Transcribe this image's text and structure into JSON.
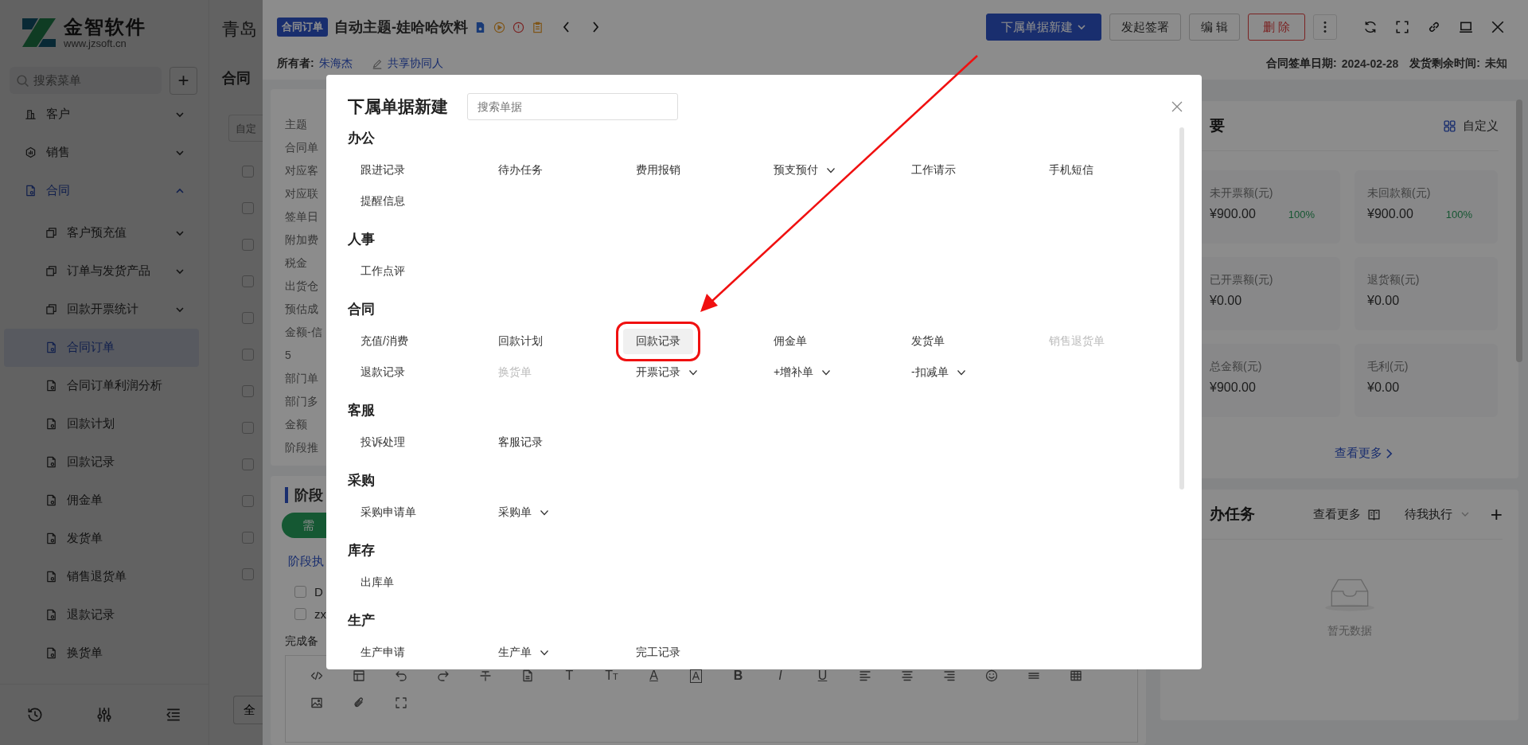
{
  "sidebar": {
    "logo": {
      "name": "金智软件",
      "url": "www.jzsoft.cn"
    },
    "search": {
      "placeholder": "搜索菜单"
    },
    "add_button": "+",
    "items": [
      {
        "label": "客户",
        "expanded": false
      },
      {
        "label": "销售",
        "expanded": false
      },
      {
        "label": "合同",
        "expanded": true,
        "children": [
          {
            "label": "客户预充值",
            "selected": false,
            "expanded": false
          },
          {
            "label": "订单与发货产品",
            "selected": false,
            "expanded": false
          },
          {
            "label": "回款开票统计",
            "selected": false,
            "expanded": false
          },
          {
            "label": "合同订单",
            "selected": true
          },
          {
            "label": "合同订单利润分析",
            "selected": false
          },
          {
            "label": "回款计划",
            "selected": false
          },
          {
            "label": "回款记录",
            "selected": false
          },
          {
            "label": "佣金单",
            "selected": false
          },
          {
            "label": "发货单",
            "selected": false
          },
          {
            "label": "销售退货单",
            "selected": false
          },
          {
            "label": "退款记录",
            "selected": false
          },
          {
            "label": "换货单",
            "selected": false
          }
        ]
      }
    ]
  },
  "background_page": {
    "title": "青岛",
    "section_title": "合同",
    "filter": {
      "placeholder": "自定"
    },
    "list_checkboxes": [
      {
        "checked": false
      },
      {
        "checked": false
      },
      {
        "checked": false
      },
      {
        "checked": false
      },
      {
        "checked": false
      },
      {
        "checked": false
      },
      {
        "checked": false
      },
      {
        "checked": false
      },
      {
        "checked": false
      },
      {
        "checked": false
      },
      {
        "checked": false
      },
      {
        "checked": false
      }
    ],
    "footer_button": "全"
  },
  "drawer": {
    "tag": "合同订单",
    "title": "自动主题-娃哈哈饮料",
    "buttons": [
      {
        "label": "下属单据新建",
        "kind": "primary"
      },
      {
        "label": "发起签署",
        "kind": "default"
      },
      {
        "label": "编 辑",
        "kind": "default"
      },
      {
        "label": "删 除",
        "kind": "danger"
      }
    ],
    "owner_label": "所有者:",
    "owner": "朱海杰",
    "share_link": "共享协同人",
    "meta": [
      {
        "label": "合同签单日期:",
        "value": "2024-02-28"
      },
      {
        "label": "发货剩余时间:",
        "value": "未知"
      }
    ]
  },
  "detail_fields": [
    "主题",
    "合同单",
    "对应客",
    "对应联",
    "签单日",
    "附加费",
    "税金",
    "出货仓",
    "预估成",
    "金额-信",
    "5",
    "部门单",
    "部门多",
    "金额",
    "阶段推"
  ],
  "stage": {
    "title": "阶段",
    "stage_button": "需",
    "link": "阶段执",
    "checklist": [
      {
        "label": "D",
        "checked": false
      },
      {
        "label": "zx",
        "checked": false
      }
    ],
    "remark_label": "完成备",
    "toolbar_glyphs": [
      {
        "text": "T",
        "kind": "plain"
      },
      {
        "text": "T",
        "small": "T",
        "kind": "plain"
      },
      {
        "text": "A",
        "kind": "underline"
      },
      {
        "text": "A",
        "kind": "boxed"
      },
      {
        "text": "B",
        "kind": "bold"
      },
      {
        "text": "I",
        "kind": "italic"
      },
      {
        "text": "U",
        "kind": "underline"
      }
    ]
  },
  "summary": {
    "title": "要",
    "customize": "自定义",
    "more": "查看更多",
    "tiles": [
      {
        "label": "未开票额(元)",
        "value": "¥900.00",
        "percent": "100%"
      },
      {
        "label": "未回款额(元)",
        "value": "¥900.00",
        "percent": "100%"
      },
      {
        "label": "已开票额(元)",
        "value": "¥0.00"
      },
      {
        "label": "退货额(元)",
        "value": "¥0.00"
      },
      {
        "label": "总金额(元)",
        "value": "¥900.00"
      },
      {
        "label": "毛利(元)",
        "value": "¥0.00"
      }
    ]
  },
  "tasks": {
    "title": "办任务",
    "more": "查看更多",
    "filter": "待我执行",
    "add": "+",
    "empty": "暂无数据"
  },
  "modal": {
    "title": "下属单据新建",
    "search": {
      "placeholder": "搜索单据"
    },
    "sections": [
      {
        "title": "办公",
        "items": [
          {
            "label": "跟进记录",
            "disabled": false,
            "menu": false,
            "selected": false
          },
          {
            "label": "待办任务",
            "disabled": false,
            "menu": false,
            "selected": false
          },
          {
            "label": "费用报销",
            "disabled": false,
            "menu": false,
            "selected": false
          },
          {
            "label": "预支预付",
            "disabled": false,
            "menu": true,
            "selected": false
          },
          {
            "label": "工作请示",
            "disabled": false,
            "menu": false,
            "selected": false
          },
          {
            "label": "手机短信",
            "disabled": false,
            "menu": false,
            "selected": false
          },
          {
            "label": "提醒信息",
            "disabled": false,
            "menu": false,
            "selected": false
          }
        ]
      },
      {
        "title": "人事",
        "items": [
          {
            "label": "工作点评",
            "disabled": false,
            "menu": false,
            "selected": false
          }
        ]
      },
      {
        "title": "合同",
        "items": [
          {
            "label": "充值/消费",
            "disabled": false,
            "menu": false,
            "selected": false
          },
          {
            "label": "回款计划",
            "disabled": false,
            "menu": false,
            "selected": false
          },
          {
            "label": "回款记录",
            "disabled": false,
            "menu": false,
            "selected": true
          },
          {
            "label": "佣金单",
            "disabled": false,
            "menu": false,
            "selected": false
          },
          {
            "label": "发货单",
            "disabled": false,
            "menu": false,
            "selected": false
          },
          {
            "label": "销售退货单",
            "disabled": true,
            "menu": false,
            "selected": false
          },
          {
            "label": "退款记录",
            "disabled": false,
            "menu": false,
            "selected": false
          },
          {
            "label": "换货单",
            "disabled": true,
            "menu": false,
            "selected": false
          },
          {
            "label": "开票记录",
            "disabled": false,
            "menu": true,
            "selected": false
          },
          {
            "label": "+增补单",
            "disabled": false,
            "menu": true,
            "selected": false
          },
          {
            "label": "-扣减单",
            "disabled": false,
            "menu": true,
            "selected": false
          }
        ]
      },
      {
        "title": "客服",
        "items": [
          {
            "label": "投诉处理",
            "disabled": false,
            "menu": false,
            "selected": false
          },
          {
            "label": "客服记录",
            "disabled": false,
            "menu": false,
            "selected": false
          }
        ]
      },
      {
        "title": "采购",
        "items": [
          {
            "label": "采购申请单",
            "disabled": false,
            "menu": false,
            "selected": false
          },
          {
            "label": "采购单",
            "disabled": false,
            "menu": true,
            "selected": false
          }
        ]
      },
      {
        "title": "库存",
        "items": [
          {
            "label": "出库单",
            "disabled": false,
            "menu": false,
            "selected": false
          }
        ]
      },
      {
        "title": "生产",
        "items": [
          {
            "label": "生产申请",
            "disabled": false,
            "menu": false,
            "selected": false
          },
          {
            "label": "生产单",
            "disabled": false,
            "menu": true,
            "selected": false
          },
          {
            "label": "完工记录",
            "disabled": false,
            "menu": false,
            "selected": false
          }
        ]
      }
    ]
  }
}
